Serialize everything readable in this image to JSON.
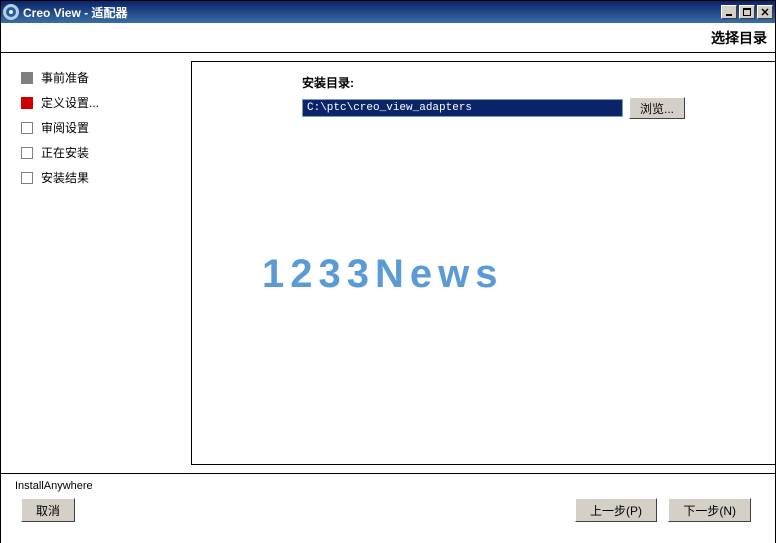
{
  "titlebar": {
    "title": "Creo View - 适配器"
  },
  "header": {
    "page_title": "选择目录"
  },
  "sidebar": {
    "steps": [
      {
        "label": "事前准备",
        "state": "done"
      },
      {
        "label": "定义设置...",
        "state": "current"
      },
      {
        "label": "审阅设置",
        "state": "pending"
      },
      {
        "label": "正在安装",
        "state": "pending"
      },
      {
        "label": "安装结果",
        "state": "pending"
      }
    ]
  },
  "content": {
    "field_label": "安装目录:",
    "path_value": "C:\\ptc\\creo_view_adapters",
    "browse_label": "浏览..."
  },
  "watermark": "1233News",
  "footer": {
    "brand": "InstallAnywhere",
    "cancel": "取消",
    "prev": "上一步(P)",
    "next": "下一步(N)"
  }
}
